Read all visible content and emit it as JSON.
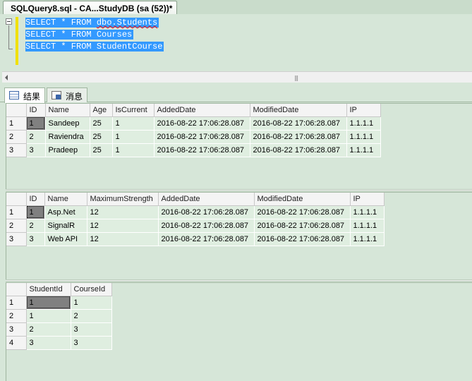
{
  "document_tab": {
    "title": "SQLQuery8.sql - CA...StudyDB (sa (52))*"
  },
  "editor": {
    "lines": [
      {
        "select": "SELECT * FROM ",
        "table": "dbo.Students"
      },
      {
        "select": "SELECT * FROM ",
        "table": "Courses"
      },
      {
        "select": "SELECT * FROM ",
        "table": "StudentCourse"
      }
    ]
  },
  "result_tabs": {
    "results_label": "结果",
    "messages_label": "消息"
  },
  "grid1": {
    "columns": [
      "ID",
      "Name",
      "Age",
      "IsCurrent",
      "AddedDate",
      "ModifiedDate",
      "IP"
    ],
    "rows": [
      [
        "1",
        "1",
        "Sandeep",
        "25",
        "1",
        "2016-08-22 17:06:28.087",
        "2016-08-22 17:06:28.087",
        "1.1.1.1"
      ],
      [
        "2",
        "2",
        "Raviendra",
        "25",
        "1",
        "2016-08-22 17:06:28.087",
        "2016-08-22 17:06:28.087",
        "1.1.1.1"
      ],
      [
        "3",
        "3",
        "Pradeep",
        "25",
        "1",
        "2016-08-22 17:06:28.087",
        "2016-08-22 17:06:28.087",
        "1.1.1.1"
      ]
    ]
  },
  "grid2": {
    "columns": [
      "ID",
      "Name",
      "MaximumStrength",
      "AddedDate",
      "ModifiedDate",
      "IP"
    ],
    "rows": [
      [
        "1",
        "1",
        "Asp.Net",
        "12",
        "2016-08-22 17:06:28.087",
        "2016-08-22 17:06:28.087",
        "1.1.1.1"
      ],
      [
        "2",
        "2",
        "SignalR",
        "12",
        "2016-08-22 17:06:28.087",
        "2016-08-22 17:06:28.087",
        "1.1.1.1"
      ],
      [
        "3",
        "3",
        "Web API",
        "12",
        "2016-08-22 17:06:28.087",
        "2016-08-22 17:06:28.087",
        "1.1.1.1"
      ]
    ]
  },
  "grid3": {
    "columns": [
      "StudentId",
      "CourseId"
    ],
    "rows": [
      [
        "1",
        "1",
        "1"
      ],
      [
        "2",
        "1",
        "2"
      ],
      [
        "3",
        "2",
        "3"
      ],
      [
        "4",
        "3",
        "3"
      ]
    ]
  }
}
